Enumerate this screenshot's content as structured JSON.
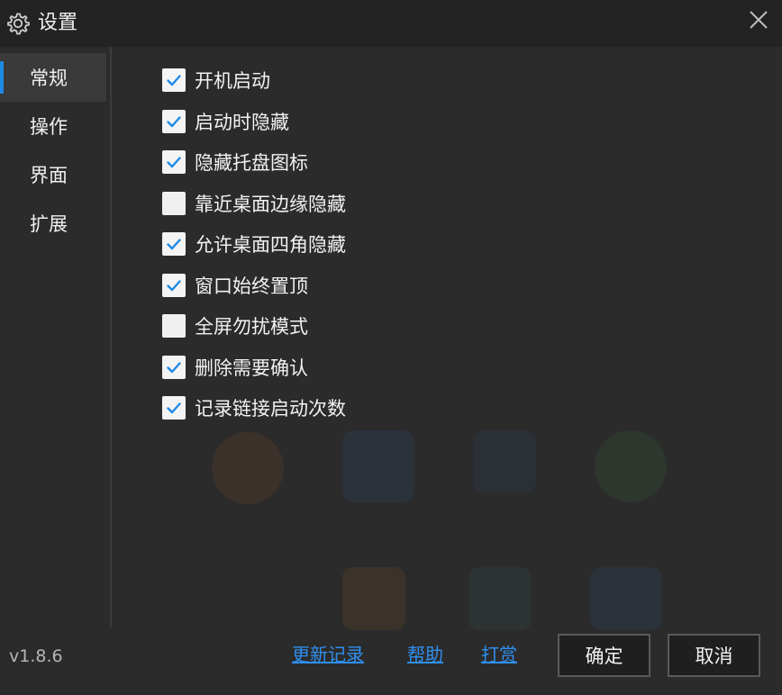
{
  "window": {
    "title": "设置",
    "icon": "gear-icon"
  },
  "sidebar": {
    "items": [
      {
        "label": "常规",
        "active": true
      },
      {
        "label": "操作",
        "active": false
      },
      {
        "label": "界面",
        "active": false
      },
      {
        "label": "扩展",
        "active": false
      }
    ]
  },
  "options": [
    {
      "label": "开机启动",
      "checked": true
    },
    {
      "label": "启动时隐藏",
      "checked": true
    },
    {
      "label": "隐藏托盘图标",
      "checked": true
    },
    {
      "label": "靠近桌面边缘隐藏",
      "checked": false
    },
    {
      "label": "允许桌面四角隐藏",
      "checked": true
    },
    {
      "label": "窗口始终置顶",
      "checked": true
    },
    {
      "label": "全屏勿扰模式",
      "checked": false
    },
    {
      "label": "删除需要确认",
      "checked": true
    },
    {
      "label": "记录链接启动次数",
      "checked": true
    }
  ],
  "footer": {
    "version": "v1.8.6",
    "links": {
      "changelog": "更新记录",
      "help": "帮助",
      "donate": "打赏"
    },
    "buttons": {
      "ok": "确定",
      "cancel": "取消"
    }
  },
  "colors": {
    "accent": "#1e8ae6",
    "link": "#2f8ff0",
    "background": "#2b2b2b",
    "titlebar": "#232323"
  }
}
